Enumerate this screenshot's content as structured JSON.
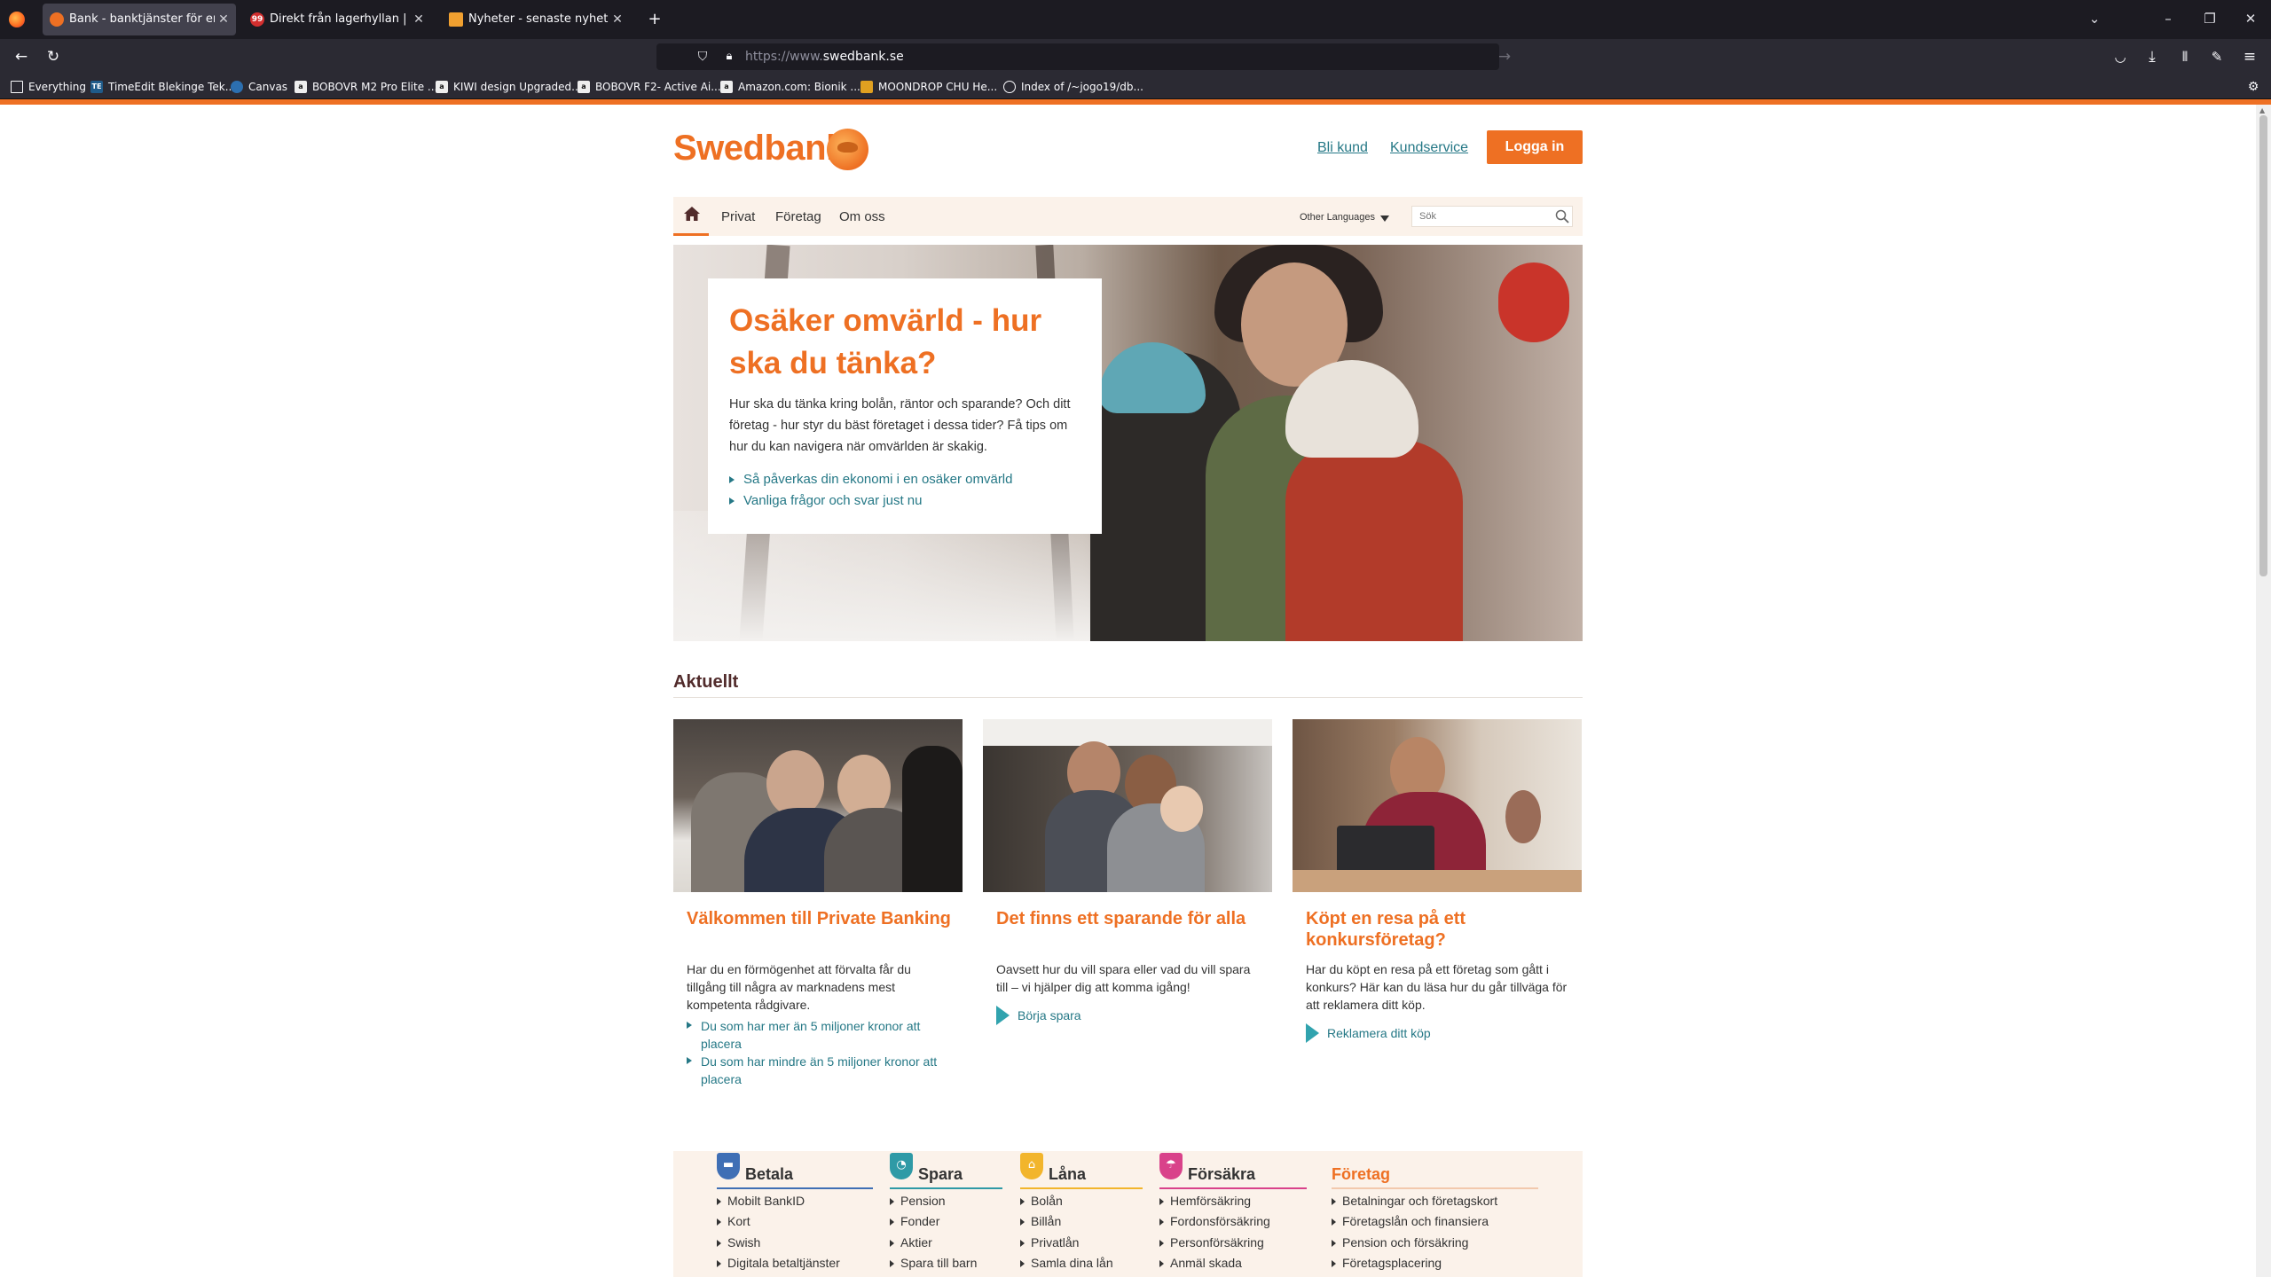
{
  "browser": {
    "tabs": [
      {
        "title": "Bank - banktjänster för en hållbar",
        "favicon_color": "#ee7023",
        "active": true
      },
      {
        "title": "Direkt från lagerhyllan | NetOnNet",
        "favicon_color": "#d32f2f",
        "favicon_text": "99",
        "active": false
      },
      {
        "title": "Nyheter - senaste nyheterna i Sverige",
        "favicon_color": "#f0a030",
        "active": false
      }
    ],
    "new_tab": "+",
    "url_prefix": "https://www.",
    "url_domain": "swedbank.se",
    "bookmarks": [
      {
        "label": "Everything",
        "icon": "folder-icon",
        "color": "#2b2a33"
      },
      {
        "label": "TimeEdit Blekinge Tek...",
        "icon": "timeedit-icon",
        "color": "#1f5b8a"
      },
      {
        "label": "Canvas",
        "icon": "canvas-icon",
        "color": "#2c6fb0"
      },
      {
        "label": "BOBOVR M2 Pro Elite ...",
        "icon": "amazon-icon",
        "color": "#eeeeee"
      },
      {
        "label": "KIWI design Upgraded...",
        "icon": "amazon-icon",
        "color": "#eeeeee"
      },
      {
        "label": "BOBOVR F2- Active Ai...",
        "icon": "amazon-icon",
        "color": "#eeeeee"
      },
      {
        "label": "Amazon.com: Bionik ...",
        "icon": "amazon-icon",
        "color": "#eeeeee"
      },
      {
        "label": "MOONDROP CHU He...",
        "icon": "moondrop-icon",
        "color": "#e0a020"
      },
      {
        "label": "Index of /~jogo19/db...",
        "icon": "globe-icon",
        "color": "#2b2a33"
      }
    ]
  },
  "site": {
    "logo": "Swedbank",
    "top_links": {
      "bli_kund": "Bli kund",
      "kundservice": "Kundservice"
    },
    "login": "Logga in",
    "nav": [
      "Privat",
      "Företag",
      "Om oss"
    ],
    "languages": "Other Languages",
    "search_placeholder": "Sök",
    "hero": {
      "title": "Osäker omvärld - hur ska du tänka?",
      "text": "Hur ska du tänka kring bolån, räntor och sparande? Och ditt företag - hur styr du bäst företaget i dessa tider? Få tips om hur du kan navigera när omvärlden är skakig.",
      "links": [
        "Så påverkas din ekonomi i en osäker omvärld",
        "Vanliga frågor och svar just nu"
      ]
    },
    "section_title": "Aktuellt",
    "cards": [
      {
        "title": "Välkommen till Private Banking",
        "text": "Har du en förmögenhet att förvalta får du tillgång till några av marknadens mest kompetenta rådgivare.",
        "links": [
          "Du som har mer än 5 miljoner kronor att placera",
          "Du som har mindre än 5 miljoner kronor att placera"
        ]
      },
      {
        "title": "Det finns ett sparande för alla",
        "text": "Oavsett hur du vill spara eller vad du vill spara till – vi hjälper dig att komma igång!",
        "cta": "Börja spara"
      },
      {
        "title": "Köpt en resa på ett konkursföretag?",
        "text": "Har du köpt en resa på ett företag som gått i konkurs? Här kan du läsa hur du går tillväga för att reklamera ditt köp.",
        "cta": "Reklamera ditt köp"
      }
    ],
    "footer": [
      {
        "title": "Betala",
        "icon": "card-icon",
        "color": "#3f6fb5",
        "items": [
          "Mobilt BankID",
          "Kort",
          "Swish",
          "Digitala betaltjänster"
        ]
      },
      {
        "title": "Spara",
        "icon": "piggy-icon",
        "color": "#2f9aa6",
        "items": [
          "Pension",
          "Fonder",
          "Aktier",
          "Spara till barn"
        ]
      },
      {
        "title": "Låna",
        "icon": "house-icon",
        "color": "#f2b52c",
        "items": [
          "Bolån",
          "Billån",
          "Privatlån",
          "Samla dina lån"
        ]
      },
      {
        "title": "Försäkra",
        "icon": "umbrella-icon",
        "color": "#d9428a",
        "items": [
          "Hemförsäkring",
          "Fordonsförsäkring",
          "Personförsäkring",
          "Anmäl skada"
        ]
      },
      {
        "title": "Företag",
        "icon": "",
        "color": "#ee7023",
        "items": [
          "Betalningar och företagskort",
          "Företagslån och finansiera",
          "Pension och försäkring",
          "Företagsplacering"
        ]
      }
    ]
  }
}
